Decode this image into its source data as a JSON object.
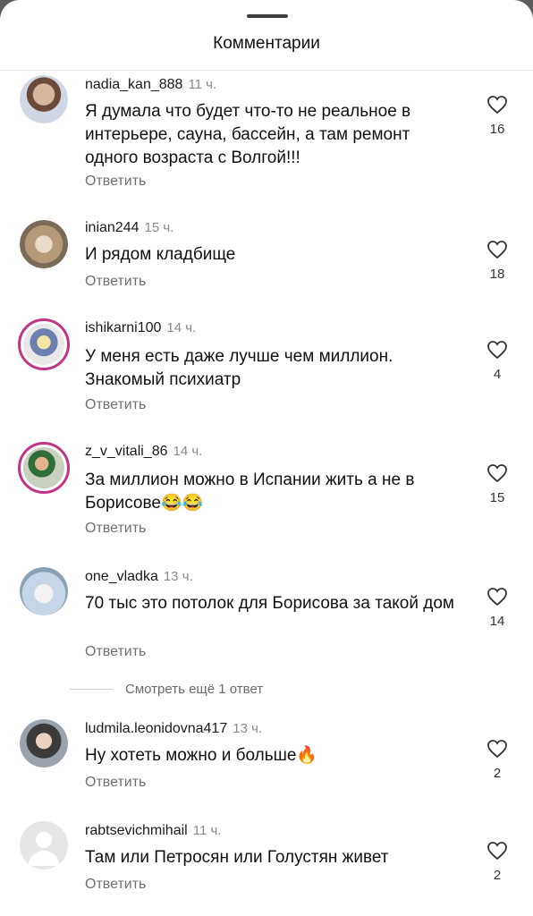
{
  "header": {
    "title": "Комментарии"
  },
  "reply_label": "Ответить",
  "view_more": "Смотреть ещё 1 ответ",
  "comments": [
    {
      "user": "nadia_kan_888",
      "time": "11 ч.",
      "text": "Я думала что будет что-то не реальное в интерьере, сауна, бассейн, а там ремонт одного возраста с Волгой!!!",
      "likes": "16"
    },
    {
      "user": "inian244",
      "time": "15 ч.",
      "text": "И рядом кладбище",
      "likes": "18"
    },
    {
      "user": "ishikarni100",
      "time": "14 ч.",
      "text": "У меня есть даже лучше чем миллион. Знакомый психиатр",
      "likes": "4"
    },
    {
      "user": "z_v_vitali_86",
      "time": "14 ч.",
      "text": "За миллион можно в Испании жить а не в Борисове😂😂",
      "likes": "15"
    },
    {
      "user": "one_vladka",
      "time": "13 ч.",
      "text": "70 тыс это потолок для Борисова за такой дом",
      "likes": "14"
    },
    {
      "user": "ludmila.leonidovna417",
      "time": "13 ч.",
      "text": "Ну хотеть можно и больше🔥",
      "likes": "2"
    },
    {
      "user": "rabtsevichmihail",
      "time": "11 ч.",
      "text": "Там или Петросян или Голустян живет",
      "likes": "2"
    }
  ],
  "colors": {
    "story_ring": "#c13584",
    "muted": "#707070"
  },
  "icons": {
    "like": "heart-outline-icon"
  }
}
